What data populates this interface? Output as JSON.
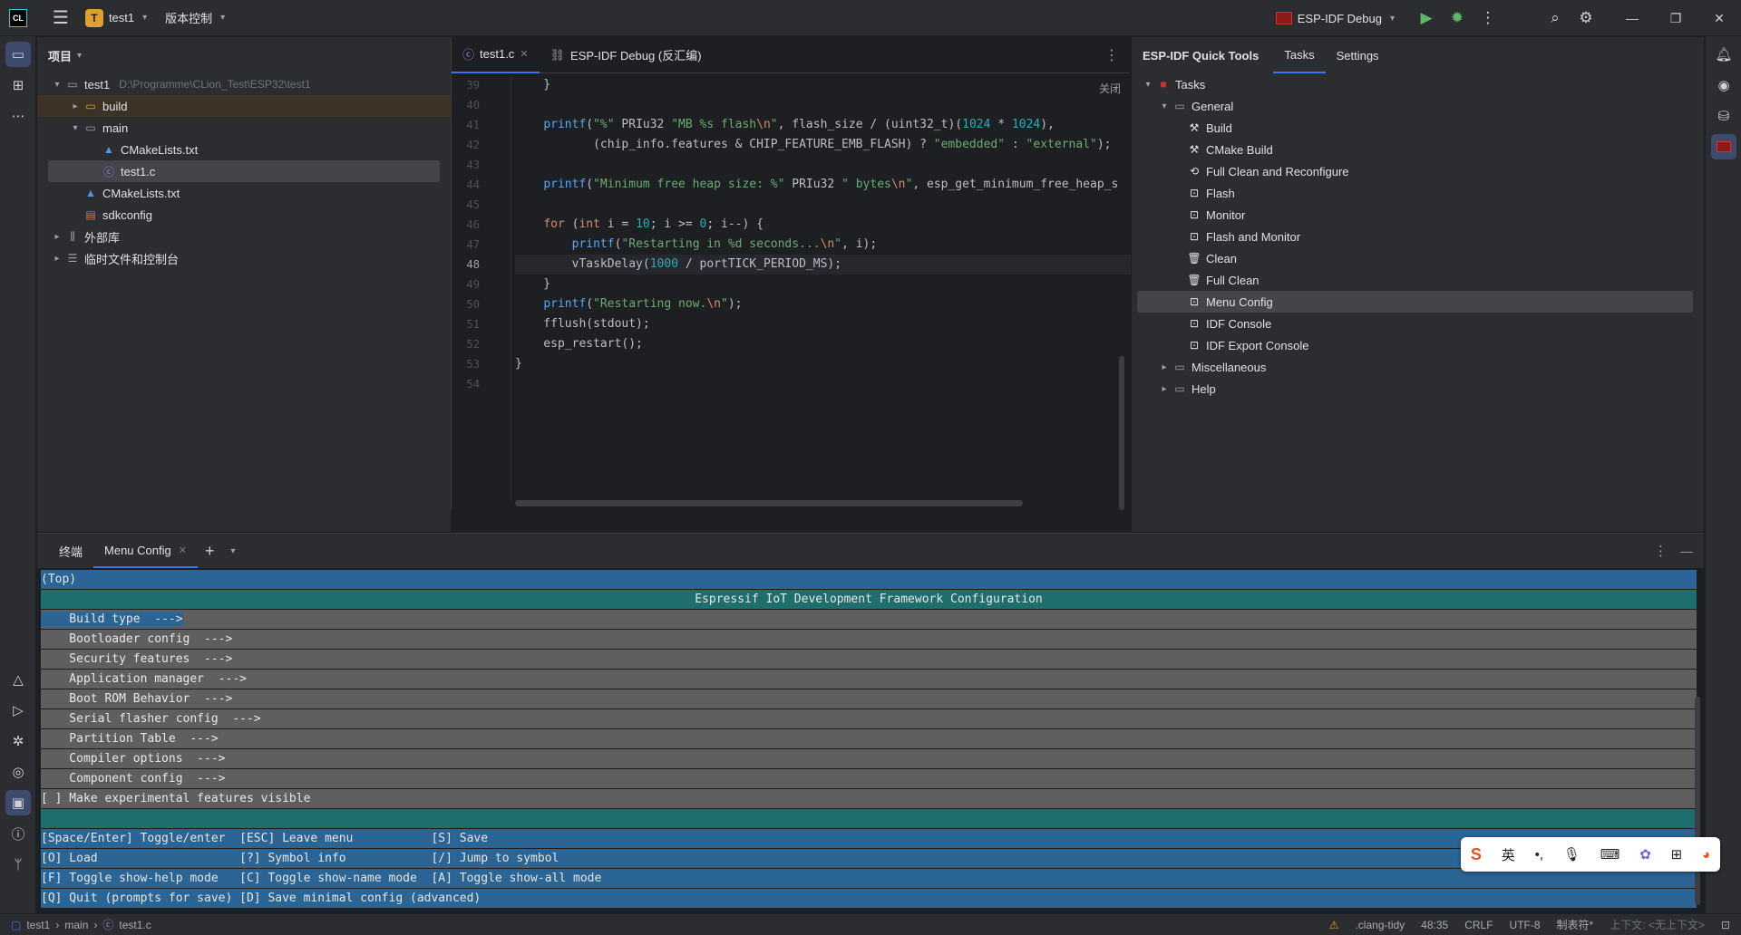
{
  "titlebar": {
    "logo": "CL",
    "project_badge": "T",
    "project_name": "test1",
    "vcs_label": "版本控制",
    "run_config": "ESP-IDF Debug"
  },
  "project_panel": {
    "title": "项目",
    "tree": [
      {
        "label": "test1",
        "path": "D:\\Programme\\CLion_Test\\ESP32\\test1",
        "depth": 0,
        "expanded": true,
        "icon": "folder-icon"
      },
      {
        "label": "build",
        "depth": 1,
        "expanded": false,
        "icon": "folder-icon"
      },
      {
        "label": "main",
        "depth": 1,
        "expanded": true,
        "icon": "folder-icon"
      },
      {
        "label": "CMakeLists.txt",
        "depth": 2,
        "icon": "cmake-icon"
      },
      {
        "label": "test1.c",
        "depth": 2,
        "icon": "c-file-icon",
        "selected": true
      },
      {
        "label": "CMakeLists.txt",
        "depth": 1,
        "icon": "cmake-icon"
      },
      {
        "label": "sdkconfig",
        "depth": 1,
        "icon": "config-file-icon"
      },
      {
        "label": "外部库",
        "depth": 0,
        "expanded": false,
        "icon": "library-icon"
      },
      {
        "label": "临时文件和控制台",
        "depth": 0,
        "expanded": false,
        "icon": "scratch-icon"
      }
    ]
  },
  "editor": {
    "tabs": [
      {
        "label": "test1.c",
        "active": true
      },
      {
        "label": "ESP-IDF Debug (反汇编)",
        "active": false
      }
    ],
    "close_hint": "关闭",
    "current_line": 48,
    "lines": [
      39,
      40,
      41,
      42,
      43,
      44,
      45,
      46,
      47,
      48,
      49,
      50,
      51,
      52,
      53,
      54
    ]
  },
  "quick_tools": {
    "title": "ESP-IDF Quick Tools",
    "tabs": [
      "Tasks",
      "Settings"
    ],
    "root": "Tasks",
    "general_label": "General",
    "tasks": [
      "Build",
      "CMake Build",
      "Full Clean and Reconfigure",
      "Flash",
      "Monitor",
      "Flash and Monitor",
      "Clean",
      "Full Clean",
      "Menu Config",
      "IDF Console",
      "IDF Export Console"
    ],
    "selected_task": "Menu Config",
    "other_groups": [
      "Miscellaneous",
      "Help"
    ]
  },
  "terminal": {
    "tabs": [
      "终端",
      "Menu Config"
    ],
    "top_label": "(Top)",
    "header": "Espressif IoT Development Framework Configuration",
    "menu_items": [
      "    Build type  --->",
      "    Bootloader config  --->",
      "    Security features  --->",
      "    Application manager  --->",
      "    Boot ROM Behavior  --->",
      "    Serial flasher config  --->",
      "    Partition Table  --->",
      "    Compiler options  --->",
      "    Component config  --->",
      "[ ] Make experimental features visible"
    ],
    "help_lines": [
      "[Space/Enter] Toggle/enter  [ESC] Leave menu           [S] Save",
      "[O] Load                    [?] Symbol info            [/] Jump to symbol",
      "[F] Toggle show-help mode   [C] Toggle show-name mode  [A] Toggle show-all mode",
      "[Q] Quit (prompts for save) [D] Save minimal config (advanced)"
    ]
  },
  "ime": {
    "lang": "英"
  },
  "statusbar": {
    "breadcrumb": [
      "test1",
      "main",
      "test1.c"
    ],
    "linter": ".clang-tidy",
    "position": "48:35",
    "line_ending": "CRLF",
    "encoding": "UTF-8",
    "indent": "制表符*",
    "context": "上下文",
    "no_context": "<无上下文>"
  }
}
